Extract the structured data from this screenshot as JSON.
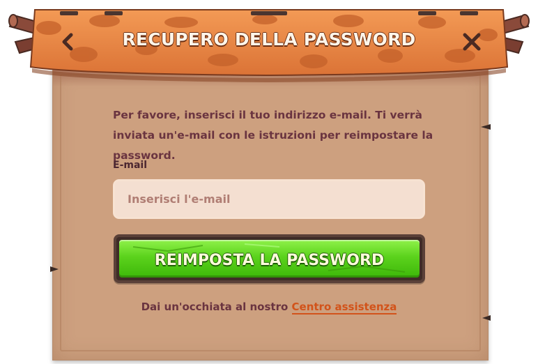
{
  "dialog": {
    "title": "RECUPERO DELLA PASSWORD",
    "back_icon": "chevron-left-icon",
    "close_icon": "close-icon",
    "instructions": "Per favore, inserisci il tuo indirizzo e-mail. Ti verrà inviata un'e-mail con le istruzioni per reimpostare la password.",
    "email_label": "E-mail",
    "email_placeholder": "Inserisci l'e-mail",
    "email_value": "",
    "submit_label": "REIMPOSTA LA PASSWORD",
    "help_prefix": "Dai un'occhiata al nostro",
    "help_link": "Centro assistenza"
  },
  "colors": {
    "banner": "#e8874a",
    "parchment": "#cda07f",
    "button_green": "#5bd21c",
    "link": "#d2531a",
    "text": "#6a3440"
  }
}
